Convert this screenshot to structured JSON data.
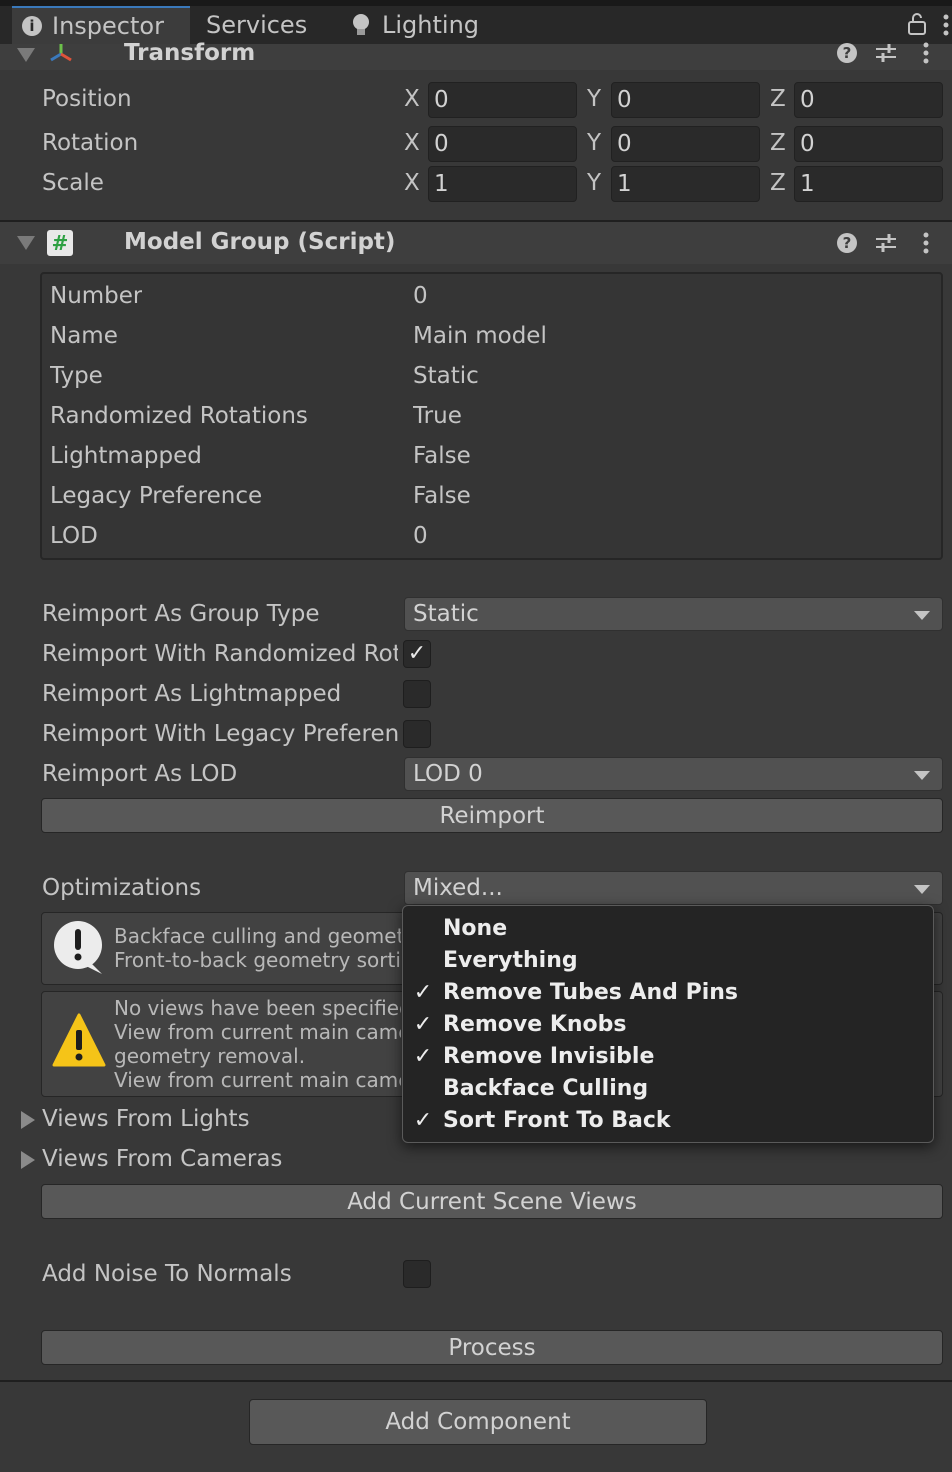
{
  "tabs": [
    {
      "label": "Inspector",
      "icon": "info-icon"
    },
    {
      "label": "Services"
    },
    {
      "label": "Lighting",
      "icon": "lightbulb-icon"
    }
  ],
  "transform": {
    "title": "Transform",
    "rows": [
      {
        "label": "Position",
        "x": "0",
        "y": "0",
        "z": "0"
      },
      {
        "label": "Rotation",
        "x": "0",
        "y": "0",
        "z": "0"
      },
      {
        "label": "Scale",
        "x": "1",
        "y": "1",
        "z": "1"
      }
    ],
    "axes": {
      "x": "X",
      "y": "Y",
      "z": "Z"
    }
  },
  "script": {
    "title": "Model Group (Script)",
    "icon_glyph": "#",
    "info": [
      {
        "label": "Number",
        "value": "0"
      },
      {
        "label": "Name",
        "value": "Main model"
      },
      {
        "label": "Type",
        "value": "Static"
      },
      {
        "label": "Randomized Rotations",
        "value": "True"
      },
      {
        "label": "Lightmapped",
        "value": "False"
      },
      {
        "label": "Legacy Preference",
        "value": "False"
      },
      {
        "label": "LOD",
        "value": "0"
      }
    ],
    "reimport_group_type_label": "Reimport As Group Type",
    "reimport_group_type_value": "Static",
    "reimport_randomized_label": "Reimport With Randomized Rota",
    "reimport_randomized_checked": true,
    "reimport_lightmapped_label": "Reimport As Lightmapped",
    "reimport_lightmapped_checked": false,
    "reimport_legacy_label": "Reimport With Legacy Preferenc",
    "reimport_legacy_checked": false,
    "reimport_lod_label": "Reimport As LOD",
    "reimport_lod_value": "LOD 0",
    "reimport_button": "Reimport",
    "optimizations_label": "Optimizations",
    "optimizations_value": "Mixed...",
    "help_info_line1": "Backface culling and geometr",
    "help_info_line2": "Front-to-back geometry sorti",
    "help_warn_line1": "No views have been specified",
    "help_warn_line2": "View from current main came",
    "help_warn_line3": "geometry removal.",
    "help_warn_line4": "View from current main came",
    "views_from_lights": "Views From Lights",
    "views_from_cameras": "Views From Cameras",
    "add_views_button": "Add Current Scene Views",
    "noise_label": "Add Noise To Normals",
    "noise_checked": false,
    "process_button": "Process"
  },
  "add_component_button": "Add Component",
  "check_glyph": "✓",
  "menu": {
    "items": [
      {
        "label": "None",
        "checked": false
      },
      {
        "label": "Everything",
        "checked": false
      },
      {
        "label": "Remove Tubes And Pins",
        "checked": true
      },
      {
        "label": "Remove Knobs",
        "checked": true
      },
      {
        "label": "Remove Invisible",
        "checked": true
      },
      {
        "label": "Backface Culling",
        "checked": false
      },
      {
        "label": "Sort Front To Back",
        "checked": true
      }
    ]
  },
  "colors": {
    "accent": "#3a79bb",
    "warning": "#f5c418",
    "script_icon": "#2ea043"
  }
}
